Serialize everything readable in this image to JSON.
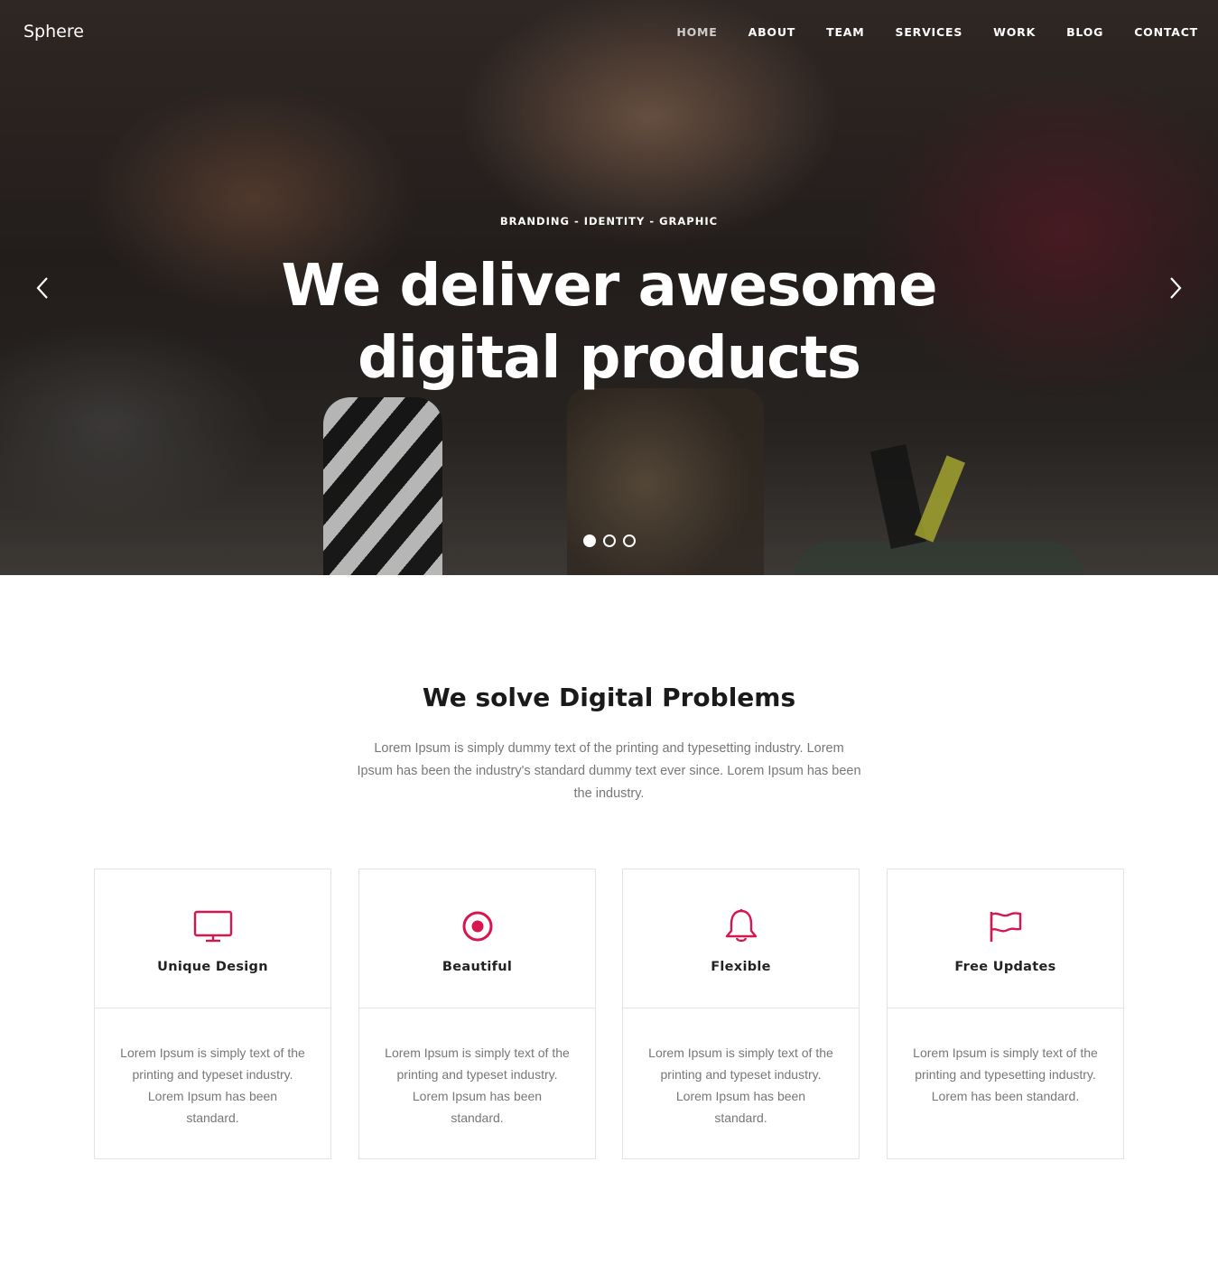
{
  "brand": "Sphere",
  "nav": [
    {
      "label": "HOME"
    },
    {
      "label": "ABOUT"
    },
    {
      "label": "TEAM"
    },
    {
      "label": "SERVICES"
    },
    {
      "label": "WORK"
    },
    {
      "label": "BLOG"
    },
    {
      "label": "CONTACT"
    }
  ],
  "hero": {
    "eyebrow": "BRANDING - IDENTITY - GRAPHIC",
    "headline_line1": "We deliver awesome",
    "headline_line2": "digital products",
    "slides_total": 3,
    "active_slide": 1
  },
  "section": {
    "title": "We solve Digital Problems",
    "description": "Lorem Ipsum is simply dummy text of the printing and typesetting industry. Lorem Ipsum has been the industry's standard dummy text ever since. Lorem Ipsum has been the industry."
  },
  "features": [
    {
      "icon": "monitor-icon",
      "title": "Unique Design",
      "text": "Lorem Ipsum is simply text of the printing and typeset industry. Lorem Ipsum has been standard."
    },
    {
      "icon": "target-icon",
      "title": "Beautiful",
      "text": "Lorem Ipsum is simply text of the printing and typeset industry. Lorem Ipsum has been standard."
    },
    {
      "icon": "bell-icon",
      "title": "Flexible",
      "text": "Lorem Ipsum is simply text of the printing and typeset industry. Lorem Ipsum has been standard."
    },
    {
      "icon": "flag-icon",
      "title": "Free Updates",
      "text": "Lorem Ipsum is simply text of the printing and typesetting industry. Lorem has been standard."
    }
  ],
  "colors": {
    "accent": "#d6164f",
    "text_muted": "#777777",
    "heading": "#1a1a1a"
  }
}
